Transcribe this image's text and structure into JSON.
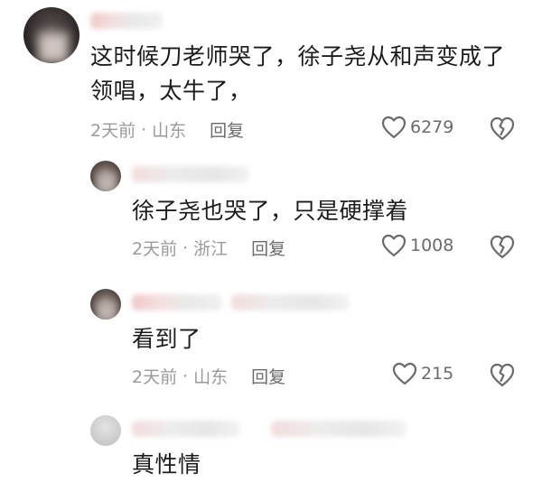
{
  "comments": [
    {
      "text_line1": "这时候刀老师哭了，徐子尧从和声变成了",
      "text_line2": "领唱，太牛了，",
      "time": "2天前",
      "location": "山东",
      "reply": "回复",
      "likes": "6279"
    },
    {
      "text_line1": "徐子尧也哭了，只是硬撑着",
      "time": "2天前",
      "location": "浙江",
      "reply": "回复",
      "likes": "1008"
    },
    {
      "text_line1": "看到了",
      "time": "2天前",
      "location": "山东",
      "reply": "回复",
      "likes": "215"
    },
    {
      "text_line1": "真性情"
    }
  ],
  "separator": "·",
  "icons": {
    "like": "heart-outline-icon",
    "dislike": "broken-heart-icon"
  },
  "colors": {
    "text": "#1c1c1c",
    "meta": "#9a9a9a",
    "action": "#6b6b6b"
  }
}
